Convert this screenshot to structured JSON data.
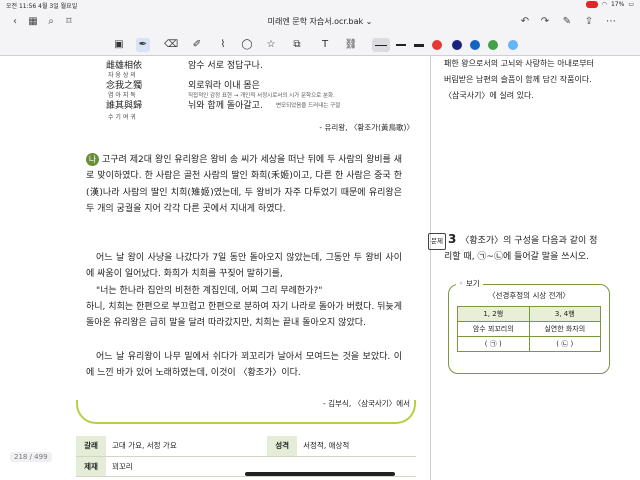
{
  "status": {
    "time": "오전 11:56",
    "date": "4월 3일 월요일",
    "battery": "17%"
  },
  "nav": {
    "title": "미래엔 문학 자습서.ocr.bak"
  },
  "toolbar": {
    "colors": [
      "#111111",
      "#e53935",
      "#1a237e",
      "#1565c0",
      "#43a047",
      "#64b5f6"
    ]
  },
  "poem": {
    "hanja1": "雌雄相依",
    "read1": "자 웅 상 의",
    "hanja2": "念我之獨",
    "read2": "염 아 지 독",
    "hanja3": "誰其與歸",
    "read3": "수 기 여 귀",
    "line1": "암수 서로 정답구나.",
    "line2": "외로워라 이내 몸은",
    "annot1": "직접적인 감정 표현 → 개인적 서정시로서의 시가 문학으로 분화.",
    "line3": "뉘와 함께 돌아갈고.",
    "annot2": "변모되었음을 드러내는 구절",
    "source": "- 유리왕, 〈황조가(黃鳥歌)〉"
  },
  "body": {
    "marker": "나",
    "p1": "고구려 제2대 왕인 유리왕은 왕비 송 씨가 세상을 떠난 뒤에 두 사람의 왕비를 새로 맞이하였다. 한 사람은 골천 사람의 딸인 화희(禾姬)이고, 다른 한 사람은 중국 한(漢)나라 사람의 딸인 치희(雉姬)였는데, 두 왕비가 자주 다투었기 때문에 유리왕은 두 개의 궁궐을 지어 각각 다른 곳에서 지내게 하였다.",
    "p2": "어느 날 왕이 사냥을 나갔다가 7일 동안 돌아오지 않았는데, 그동안 두 왕비 사이에 싸움이 일어났다. 화희가 치희를 꾸짖어 말하기를,",
    "p3": "\"너는 한나라 집안의 비천한 계집인데, 어찌 그리 무례한가?\"",
    "p4": "하니, 치희는 한편으로 부끄럽고 한편으로 분하여 자기 나라로 돌아가 버렸다. 뒤늦게 돌아온 유리왕은 급히 말을 달려 따라갔지만, 치희는 끝내 돌아오지 않았다.",
    "p5": "어느 날 유리왕이 나무 밑에서 쉬다가 꾀꼬리가 날아서 모여드는 것을 보았다. 이에 느낀 바가 있어 노래하였는데, 이것이 〈황조가〉이다.",
    "source": "- 김부식, 〈삼국사기〉에서"
  },
  "info": {
    "genre_label": "갈래",
    "genre_value": "고대 가요, 서정 가요",
    "nature_label": "성격",
    "nature_value": "서정적, 애상적",
    "theme_label": "제재",
    "theme_value": "꾀꼬리"
  },
  "right": {
    "intro1": "패한 왕으로서의 고뇌와 사랑하는 아내로부터",
    "intro2": "버림받은 남편의 슬픔이 함께 담긴 작품이다.",
    "intro3": "〈삼국사기〉에 실려 있다.",
    "q_label": "문제",
    "q_num": "3",
    "q_text1": "〈황조가〉의 구성을 다음과 같이 정",
    "q_text2": "리할 때, ㉠~㉡에 들어갈 말을 쓰시오.",
    "bogi_title": "보기",
    "bogi_sub": "〈선경후정의 시상 전개〉",
    "col1": "1, 2행",
    "col2": "3, 4행",
    "cell1a": "암수 꾀꼬리의",
    "cell1b": "( ㉠ )",
    "cell2a": "실연한 화자의",
    "cell2b": "( ㉡ )"
  },
  "page_indicator": "218 / 499"
}
